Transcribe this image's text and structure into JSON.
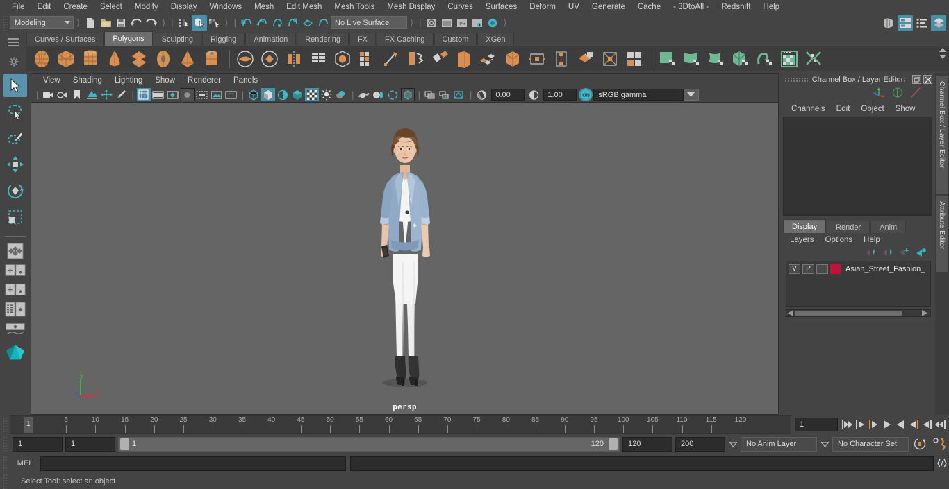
{
  "menubar": {
    "items": [
      "File",
      "Edit",
      "Create",
      "Select",
      "Modify",
      "Display",
      "Windows",
      "Mesh",
      "Edit Mesh",
      "Mesh Tools",
      "Mesh Display",
      "Curves",
      "Surfaces",
      "Deform",
      "UV",
      "Generate",
      "Cache",
      "- 3DtoAll -",
      "Redshift",
      "Help"
    ]
  },
  "statusline": {
    "menu_set": "Modeling",
    "live_surface": "No Live Surface",
    "icons": [
      "new-scene-icon",
      "open-scene-icon",
      "save-scene-icon",
      "undo-icon",
      "redo-icon",
      "select-hierarchy-icon",
      "select-object-icon",
      "select-component-icon",
      "snap-grid-icon",
      "snap-curve-icon",
      "snap-point-icon",
      "snap-projected-center-icon",
      "snap-view-plane-icon",
      "make-live-icon",
      "render-current-frame-icon",
      "render-sequence-icon",
      "ipr-render-icon",
      "render-settings-icon",
      "hypershade-icon"
    ],
    "right_icons": [
      "sidebar-toggle-icon",
      "attribute-editor-icon",
      "tool-settings-icon",
      "channel-box-icon"
    ]
  },
  "shelf": {
    "tabs": [
      "Curves / Surfaces",
      "Polygons",
      "Sculpting",
      "Rigging",
      "Animation",
      "Rendering",
      "FX",
      "FX Caching",
      "Custom",
      "XGen"
    ],
    "active_tab": "Polygons",
    "gutter_icons": [
      "shelf-menu-icon",
      "shelf-options-icon"
    ],
    "icon_names": [
      "poly-sphere-icon",
      "poly-cube-icon",
      "poly-cylinder-icon",
      "poly-cone-icon",
      "poly-plane-icon",
      "poly-torus-icon",
      "poly-pyramid-icon",
      "poly-pipe-icon",
      "poly-booleans-union-icon",
      "poly-booleans-difference-icon",
      "poly-mirror-icon",
      "poly-combine-icon",
      "poly-smooth-icon",
      "poly-extrude-icon",
      "poly-bevel-icon",
      "poly-bridge-icon",
      "poly-multicut-icon",
      "poly-wedge-icon",
      "poly-quad-draw-icon",
      "poly-chamfer-icon",
      "poly-target-weld-icon",
      "poly-merge-icon",
      "poly-connect-icon",
      "poly-detach-icon",
      "uv-planar-icon",
      "uv-cylindrical-icon",
      "uv-spherical-icon",
      "uv-automatic-icon",
      "uv-unfold-icon",
      "uv-editor-icon",
      "uv-layout-icon"
    ]
  },
  "toolbox": {
    "tools": [
      "select-tool",
      "lasso-select-tool",
      "paint-select-tool",
      "move-tool",
      "rotate-tool",
      "scale-tool"
    ],
    "active_tool": "select-tool",
    "layout_buttons": [
      "single-perspective-layout",
      "four-view-layout",
      "outliner-persp-layout",
      "hypergraph-persp-layout",
      "persp-graph-layout"
    ]
  },
  "viewport": {
    "menus": [
      "View",
      "Shading",
      "Lighting",
      "Show",
      "Renderer",
      "Panels"
    ],
    "toolbar_icons": [
      "select-camera-icon",
      "camera-attributes-icon",
      "bookmark-icon",
      "image-plane-icon",
      "two-d-pan-zoom-icon",
      "grease-pencil-icon",
      "grid-icon",
      "film-gate-icon",
      "resolution-gate-icon",
      "gate-mask-icon",
      "field-chart-icon",
      "safe-action-icon",
      "safe-title-icon",
      "wireframe-icon",
      "smooth-shade-all-icon",
      "shaded-wireframe-icon",
      "use-default-material-icon",
      "textured-icon",
      "use-all-lights-icon",
      "shadows-icon",
      "screen-space-ao-icon",
      "motion-blur-icon",
      "multisample-icon",
      "isolate-select-icon",
      "xray-icon",
      "xray-joints-icon",
      "xray-active-components-icon",
      "exposure-icon",
      "gamma-icon",
      "view-transform-toggle-icon"
    ],
    "exposure": "0.00",
    "gamma": "1.00",
    "view_transform": "sRGB gamma",
    "gamma_toggle": "ON",
    "camera_label": "persp",
    "axis": {
      "x": "x",
      "y": "y",
      "z": "z",
      "x_color": "#e03030",
      "y_color": "#30d030",
      "z_color": "#3050e8"
    },
    "background_color": "#656565"
  },
  "channelbox": {
    "title": "Channel Box / Layer Editor",
    "window_buttons": [
      "restore-icon",
      "close-icon"
    ],
    "header_icons": [
      "move-axis-icon",
      "rotate-disc-icon",
      "scale-arrow-icon"
    ],
    "menus": [
      "Channels",
      "Edit",
      "Object",
      "Show"
    ],
    "side_tabs": [
      "Channel Box / Layer Editor",
      "Attribute Editor"
    ]
  },
  "layereditor": {
    "tabs": [
      "Display",
      "Render",
      "Anim"
    ],
    "active_tab": "Display",
    "menus": [
      "Layers",
      "Options",
      "Help"
    ],
    "toolbar_icons": [
      "layer-move-up-icon",
      "layer-move-down-icon",
      "create-layer-icon",
      "create-layer-from-selected-icon"
    ],
    "layers": [
      {
        "visibility": "V",
        "playback": "P",
        "shading": "",
        "color": "#c5103a",
        "name": "Asian_Street_Fashion_"
      }
    ]
  },
  "timeslider": {
    "start_display": "1",
    "ticks": [
      5,
      10,
      15,
      20,
      25,
      30,
      35,
      40,
      45,
      50,
      55,
      60,
      65,
      70,
      75,
      80,
      85,
      90,
      95,
      100,
      105,
      110,
      115,
      120
    ],
    "range_start": 1,
    "range_end": 120,
    "current_frame": "1",
    "current_frame_field": "1",
    "playback_buttons": [
      "go-to-start-icon",
      "step-back-keyframe-icon",
      "step-back-frame-icon",
      "play-backwards-icon",
      "play-forwards-icon",
      "step-forward-frame-icon",
      "step-forward-keyframe-icon",
      "go-to-end-icon"
    ]
  },
  "rangeslider": {
    "anim_start": "1",
    "playback_start": "1",
    "slider_min_label": "1",
    "slider_max_label": "120",
    "playback_end": "120",
    "anim_end": "200",
    "anim_layer": "No Anim Layer",
    "character_set": "No Character Set",
    "right_icons": [
      "auto-key-icon",
      "animation-preferences-icon"
    ]
  },
  "commandline": {
    "language_label": "MEL",
    "input_value": "",
    "output_value": "",
    "script-editor_icon": "script-editor-icon"
  },
  "helpline": {
    "message": "Select Tool: select an object"
  }
}
